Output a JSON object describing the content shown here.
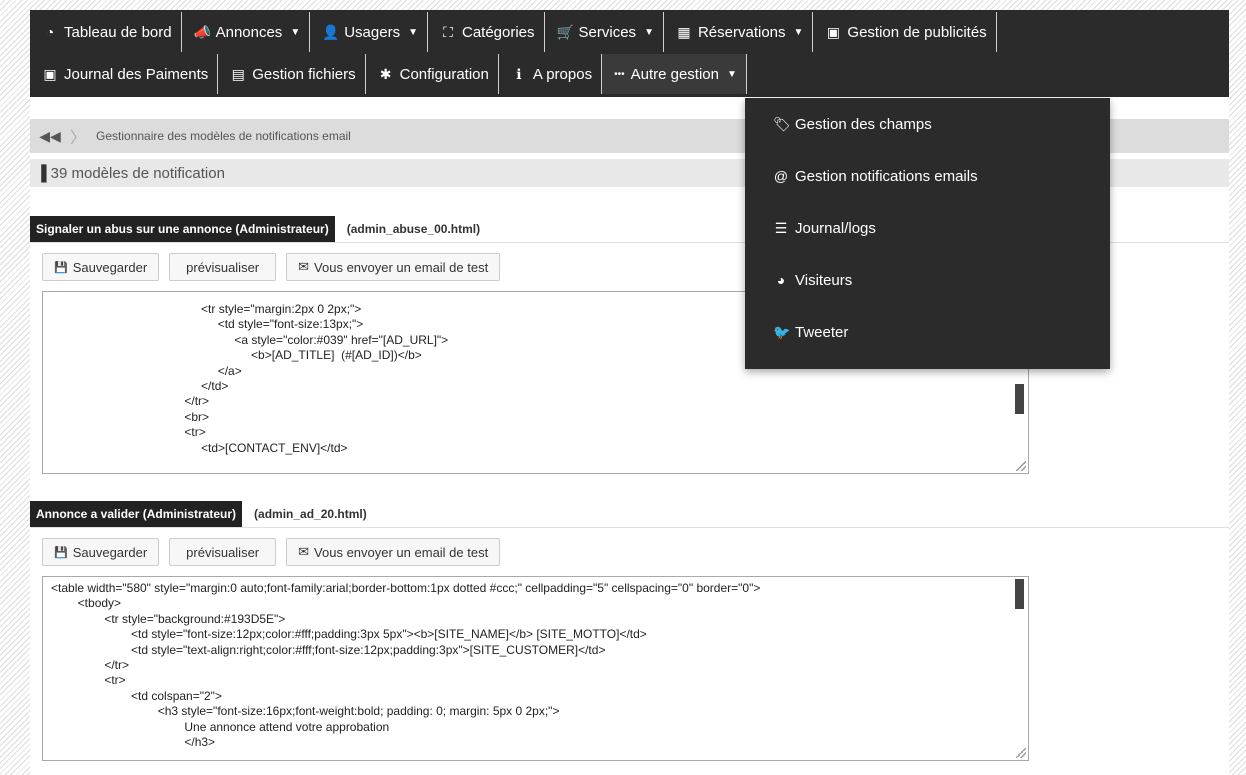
{
  "nav": {
    "row1": [
      {
        "icon": "dashboard-icon",
        "glyph": "◔",
        "label": "Tableau de bord",
        "caret": false
      },
      {
        "icon": "bullhorn-icon",
        "glyph": "📣",
        "label": "Annonces",
        "caret": true
      },
      {
        "icon": "user-icon",
        "glyph": "👤",
        "label": "Usagers",
        "caret": true
      },
      {
        "icon": "sitemap-icon",
        "glyph": "⛶",
        "label": "Catégories",
        "caret": false
      },
      {
        "icon": "cart-icon",
        "glyph": "🛒",
        "label": "Services",
        "caret": true
      },
      {
        "icon": "calendar-icon",
        "glyph": "▦",
        "label": "Réservations",
        "caret": true
      },
      {
        "icon": "money-icon",
        "glyph": "▣",
        "label": "Gestion de publicités",
        "caret": false
      }
    ],
    "row2": [
      {
        "icon": "money-icon",
        "glyph": "▣",
        "label": "Journal des Paiments",
        "caret": false
      },
      {
        "icon": "file-icon",
        "glyph": "▤",
        "label": "Gestion fichiers",
        "caret": false
      },
      {
        "icon": "gear-icon",
        "glyph": "✱",
        "label": "Configuration",
        "caret": false
      },
      {
        "icon": "info-icon",
        "glyph": "ℹ",
        "label": "A propos",
        "caret": false
      },
      {
        "icon": "ellipsis-icon",
        "glyph": "•••",
        "label": "Autre gestion",
        "caret": true
      }
    ],
    "caret_glyph": "▼"
  },
  "breadcrumb": {
    "back_glyph": "◀◀",
    "sep_glyph": "〉",
    "label": "Gestionnaire des modèles de notifications email"
  },
  "count": {
    "icon_glyph": "▐",
    "label": "39 modèles de notification"
  },
  "buttons": {
    "save": "Sauvegarder",
    "save_glyph": "💾",
    "preview": "prévisualiser",
    "test": "Vous envoyer un email de test",
    "test_glyph": "✉"
  },
  "templates": [
    {
      "name": "Signaler un abus sur une annonce (Administrateur)",
      "file": "(admin_abuse_00.html)",
      "code": "                                             <tr style=\"margin:2px 0 2px;\">\n                                                  <td style=\"font-size:13px;\">\n                                                       <a style=\"color:#039\" href=\"[AD_URL]\">\n                                                            <b>[AD_TITLE]  (#[AD_ID])</b>\n                                                  </a>\n                                             </td>\n                                        </tr>\n                                        <br>\n                                        <tr>\n                                             <td>[CONTACT_ENV]</td>",
      "thumb": "low"
    },
    {
      "name": "Annonce a valider (Administrateur)",
      "file": "(admin_ad_20.html)",
      "code": "<table width=\"580\" style=\"margin:0 auto;font-family:arial;border-bottom:1px dotted #ccc;\" cellpadding=\"5\" cellspacing=\"0\" border=\"0\">\n        <tbody>\n                <tr style=\"background:#193D5E\">\n                        <td style=\"font-size:12px;color:#fff;padding:3px 5px\"><b>[SITE_NAME]</b> [SITE_MOTTO]</td>\n                        <td style=\"text-align:right;color:#fff;font-size:12px;padding:3px\">[SITE_CUSTOMER]</td>\n                </tr>\n                <tr>\n                        <td colspan=\"2\">\n                                <h3 style=\"font-size:16px;font-weight:bold; padding: 0; margin: 5px 0 2px;\">\n                                        Une annonce attend votre approbation\n                                        </h3>",
      "thumb": "top"
    }
  ],
  "dropdown": [
    {
      "icon": "tags-icon",
      "glyph": "🏷",
      "label": "Gestion des champs"
    },
    {
      "icon": "at-icon",
      "glyph": "@",
      "label": "Gestion notifications emails"
    },
    {
      "icon": "database-icon",
      "glyph": "☰",
      "label": "Journal/logs"
    },
    {
      "icon": "globe-icon",
      "glyph": "◕",
      "label": "Visiteurs"
    },
    {
      "icon": "twitter-icon",
      "glyph": "🐦",
      "label": "Tweeter"
    }
  ]
}
